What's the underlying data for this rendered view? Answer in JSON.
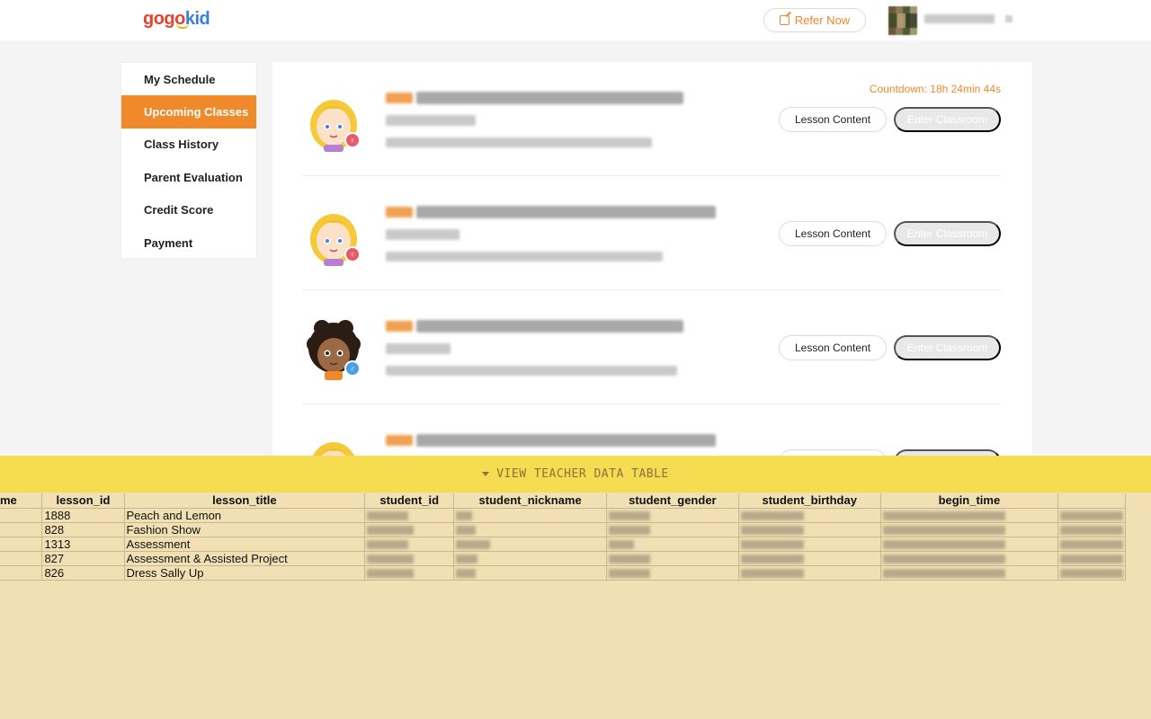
{
  "header": {
    "logo_part1": "gogo",
    "logo_part2": "kid",
    "refer_label": "Refer Now",
    "icons": {
      "refer": "edit-icon",
      "user": "avatar",
      "dropdown": "chevron-down-icon"
    }
  },
  "sidebar": {
    "items": [
      {
        "label": "My Schedule",
        "active": false
      },
      {
        "label": "Upcoming Classes",
        "active": true
      },
      {
        "label": "Class History",
        "active": false
      },
      {
        "label": "Parent Evaluation",
        "active": false
      },
      {
        "label": "Credit Score",
        "active": false
      },
      {
        "label": "Payment",
        "active": false
      }
    ]
  },
  "classes": {
    "countdown": "Countdown: 18h 24min 44s",
    "lesson_content_label": "Lesson Content",
    "enter_classroom_label": "Enter Classroom",
    "rows": [
      {
        "gender": "female"
      },
      {
        "gender": "female"
      },
      {
        "gender": "male"
      },
      {
        "gender": "female"
      }
    ]
  },
  "data_panel": {
    "toggle_label": "VIEW TEACHER DATA TABLE",
    "columns": [
      "me",
      "lesson_id",
      "lesson_title",
      "student_id",
      "student_nickname",
      "student_gender",
      "student_birthday",
      "begin_time",
      ""
    ],
    "rows": [
      {
        "lesson_id": "1888",
        "lesson_title": "Peach and Lemon"
      },
      {
        "lesson_id": "828",
        "lesson_title": "Fashion Show"
      },
      {
        "lesson_id": "1313",
        "lesson_title": "Assessment"
      },
      {
        "lesson_id": "827",
        "lesson_title": "Assessment & Assisted Project"
      },
      {
        "lesson_id": "826",
        "lesson_title": "Dress Sally Up"
      }
    ]
  },
  "colors": {
    "accent": "#f0892a",
    "panel_bar": "#f5dc50",
    "panel_bg": "#f0e0b4"
  }
}
